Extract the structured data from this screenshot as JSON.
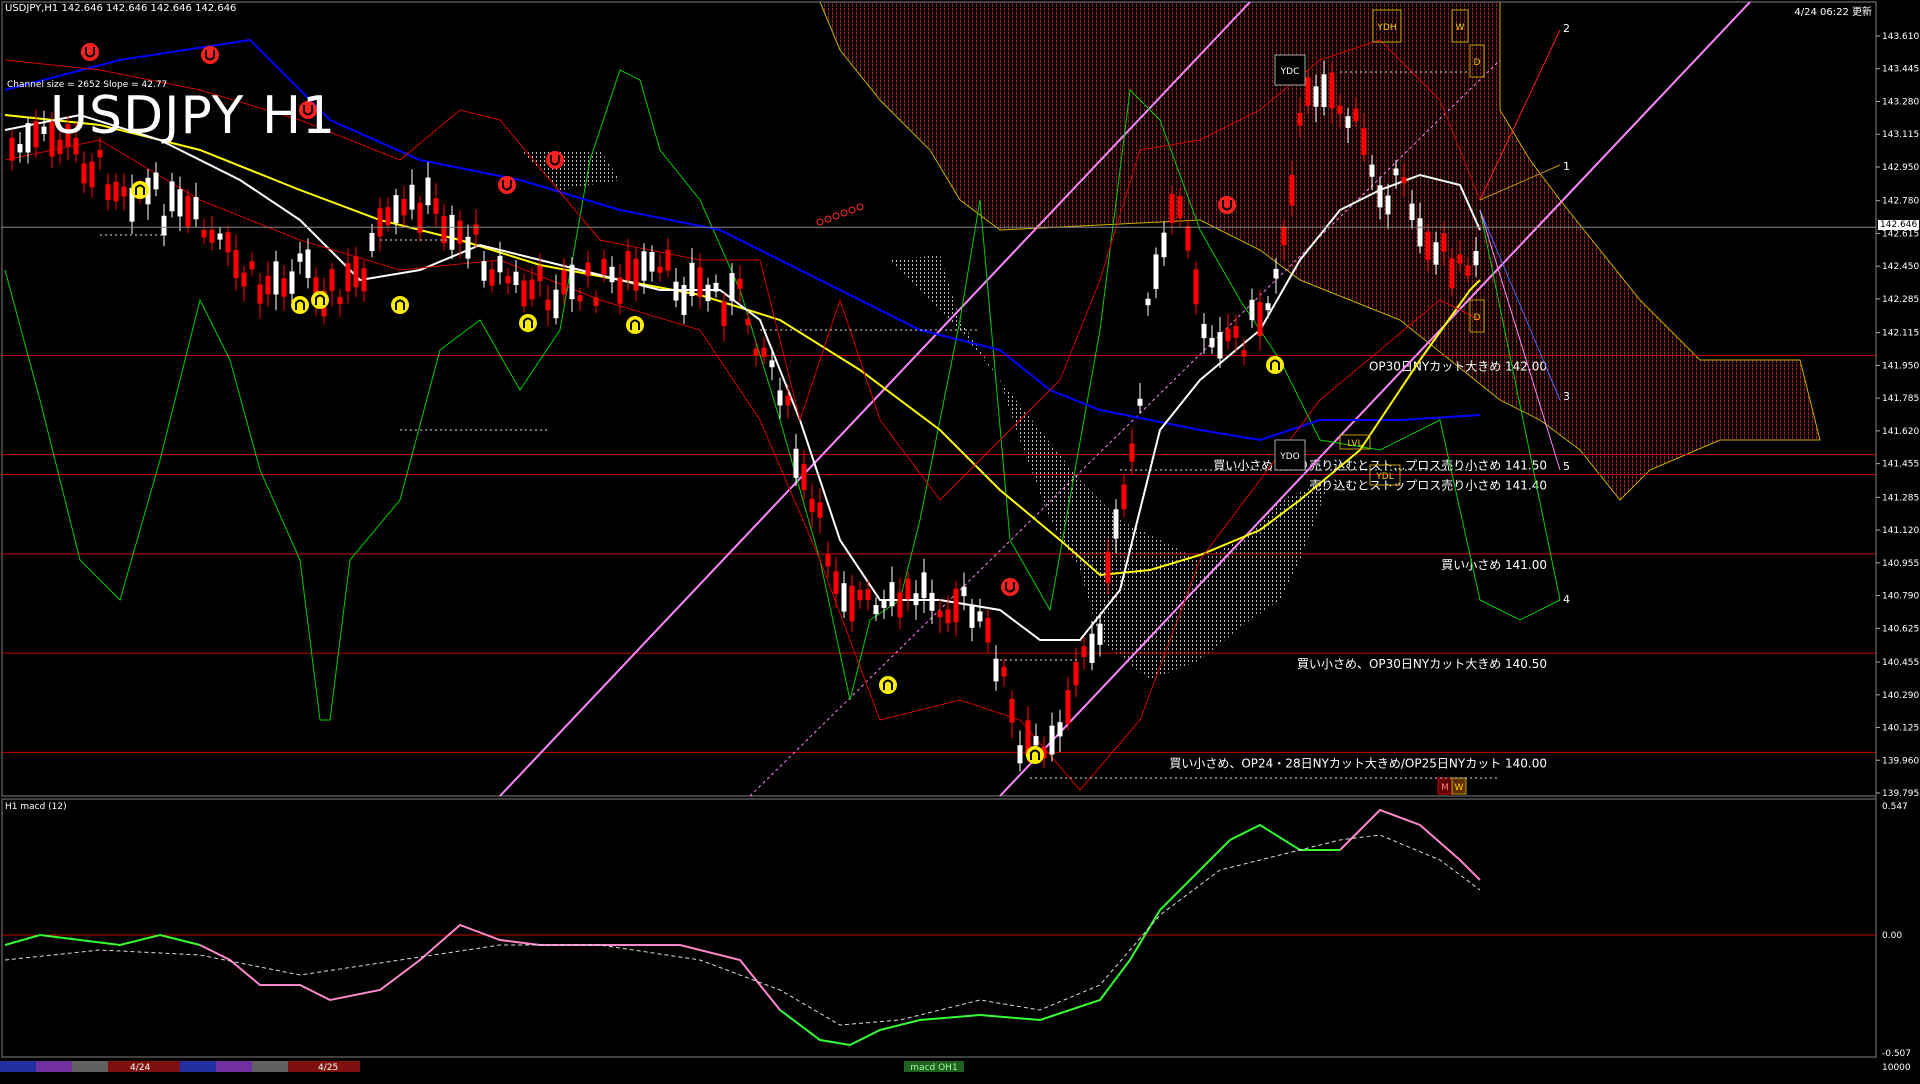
{
  "header": {
    "symbol_info": "USDJPY,H1  142.646 142.646 142.646 142.646",
    "timestamp": "4/24 06:22 更新",
    "channel_info": "Channel size = 2652 Slope = 42.77",
    "big_title": "USDJPY H1"
  },
  "price_axis": {
    "labels": [
      "143.610",
      "143.445",
      "143.280",
      "143.115",
      "142.950",
      "142.780",
      "142.615",
      "142.450",
      "142.285",
      "142.115",
      "141.950",
      "141.785",
      "141.620",
      "141.455",
      "141.285",
      "141.120",
      "140.955",
      "140.790",
      "140.625",
      "140.455",
      "140.290",
      "140.125",
      "139.960",
      "139.795"
    ],
    "current_price": "142.646"
  },
  "levels": [
    {
      "price": 142.0,
      "label": "OP30日NYカット大きめ 142.00"
    },
    {
      "price": 141.5,
      "label": "買い小さめ・戻り売り込むとスト…プロス売り小さめ 141.50"
    },
    {
      "price": 141.4,
      "label": "売り込むとストップロス売り小さめ 141.40"
    },
    {
      "price": 141.0,
      "label": "買い小さめ 141.00"
    },
    {
      "price": 140.5,
      "label": "買い小さめ、OP30日NYカット大きめ 140.50"
    },
    {
      "price": 140.0,
      "label": "買い小さめ、OP24・28日NYカット大きめ/OP25日NYカット 140.00"
    }
  ],
  "markers": {
    "ydh": "YDH",
    "ydc": "YDC",
    "ydo": "YDO",
    "ydl": "YDL",
    "w": "W",
    "d": "D",
    "lvl": "LVL",
    "m": "M"
  },
  "forecast_labels": [
    "1",
    "2",
    "3",
    "4",
    "5"
  ],
  "macd": {
    "title": "H1  macd (12)",
    "axis_labels": [
      "0.547",
      "0.00",
      "-0.507"
    ]
  },
  "bottom_bar": {
    "date_labels": [
      "4/24",
      "4/25"
    ],
    "center_label": "macd OH1",
    "right_label": "10000"
  },
  "colors": {
    "bull_candle": "#ffffff",
    "bear_candle": "#ff0000",
    "grid_level": "#c00000",
    "ma_white": "#ffffff",
    "ma_yellow": "#ffff00",
    "ma_blue": "#0000ff",
    "ichimoku_green": "#00cc00",
    "channel_pink": "#ff88ff",
    "macd_green": "#33ff33",
    "macd_pink": "#ff88cc"
  }
}
